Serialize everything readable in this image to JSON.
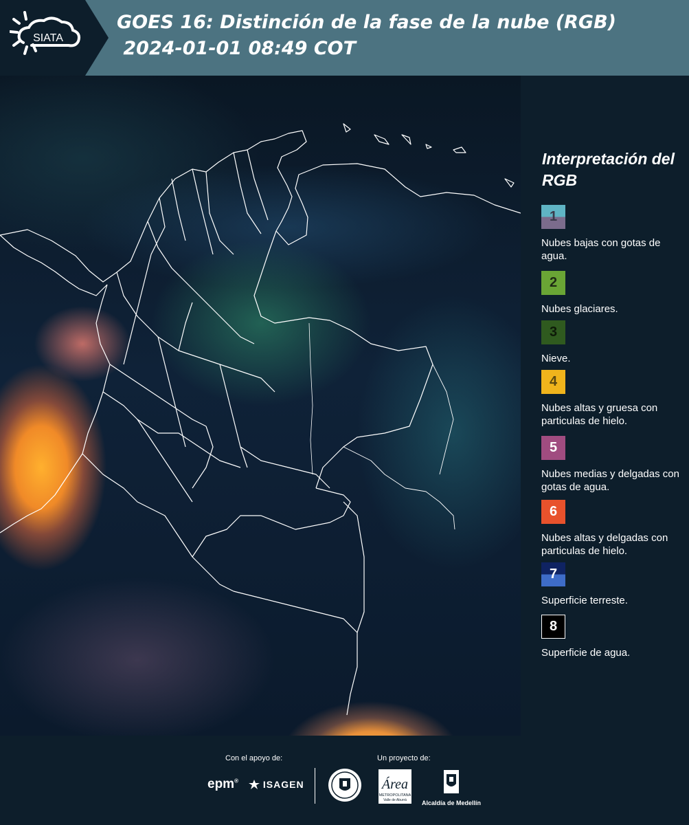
{
  "header": {
    "logo_text": "SIATA",
    "title_line1": "GOES 16: Distinción de la fase de la nube (RGB)",
    "title_line2": " 2024-01-01 08:49 COT",
    "background_color": "#4c7381"
  },
  "legend": {
    "title": "Interpretación del RGB",
    "items": [
      {
        "number": "1",
        "description": "Nubes bajas con gotas de agua.",
        "color_top": "#5fb4c4",
        "color_bottom": "#7b6c8c"
      },
      {
        "number": "2",
        "description": "Nubes glaciares.",
        "color_top": "#6aa535",
        "color_bottom": "#6aa535"
      },
      {
        "number": "3",
        "description": "Nieve.",
        "color_top": "#2f5a1f",
        "color_bottom": "#2f5a1f"
      },
      {
        "number": "4",
        "description": "Nubes altas y gruesa con particulas de hielo.",
        "color_top": "#f0b41c",
        "color_bottom": "#f0b41c"
      },
      {
        "number": "5",
        "description": "Nubes medias y delgadas con gotas de agua.",
        "color_top": "#a04c80",
        "color_bottom": "#a04c80"
      },
      {
        "number": "6",
        "description": "Nubes altas y delgadas con particulas de hielo.",
        "color_top": "#e8522c",
        "color_bottom": "#e8522c"
      },
      {
        "number": "7",
        "description": "Superficie terreste.",
        "color_top": "#0f2362",
        "color_bottom": "#3e6cc8"
      },
      {
        "number": "8",
        "description": "Superficie de agua.",
        "color_top": "#000000",
        "color_bottom": "#000000"
      }
    ]
  },
  "footer": {
    "support_label": "Con el apoyo de:",
    "project_label": "Un proyecto de:",
    "epm_logo": "epm",
    "isagen_logo": "ISAGEN",
    "area_logo_text": "Área",
    "area_subtext": "METROPOLITANA",
    "area_subtext2": "Valle de Aburrá",
    "alcaldia_label": "Alcaldía de Medellín"
  }
}
